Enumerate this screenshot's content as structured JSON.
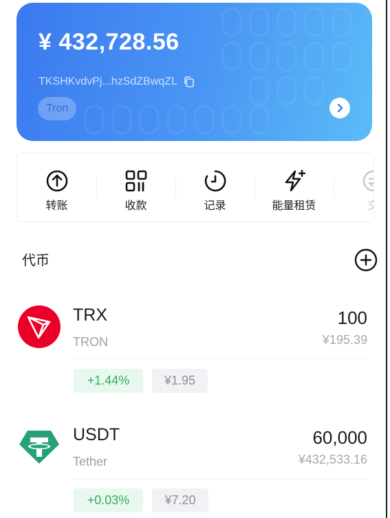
{
  "wallet": {
    "balance": "¥ 432,728.56",
    "address": "TKSHKvdvPj...hzSdZBwqZL",
    "chain": "Tron",
    "copy_icon": "copy-icon",
    "arrow_icon": "chevron-right-icon"
  },
  "actions": [
    {
      "label": "转账",
      "icon": "send-icon"
    },
    {
      "label": "收款",
      "icon": "qr-code-icon"
    },
    {
      "label": "记录",
      "icon": "history-icon"
    },
    {
      "label": "能量租赁",
      "icon": "energy-icon"
    },
    {
      "label": "交",
      "icon": "exchange-icon"
    }
  ],
  "tokens_section": {
    "title": "代币",
    "add_icon": "add-circle-icon"
  },
  "tokens": [
    {
      "symbol": "TRX",
      "name": "TRON",
      "amount": "100",
      "fiat": "¥195.39",
      "change": "+1.44%",
      "price": "¥1.95",
      "logo_color": "#eb0029",
      "logo_icon": "tron-logo-icon"
    },
    {
      "symbol": "USDT",
      "name": "Tether",
      "amount": "60,000",
      "fiat": "¥432,533.16",
      "change": "+0.03%",
      "price": "¥7.20",
      "logo_color": "#26a17b",
      "logo_icon": "tether-logo-icon"
    }
  ],
  "colors": {
    "card_gradient_start": "#3b79ef",
    "card_gradient_end": "#5bbcf7",
    "positive": "#2fb05c",
    "muted": "#999ea8"
  }
}
